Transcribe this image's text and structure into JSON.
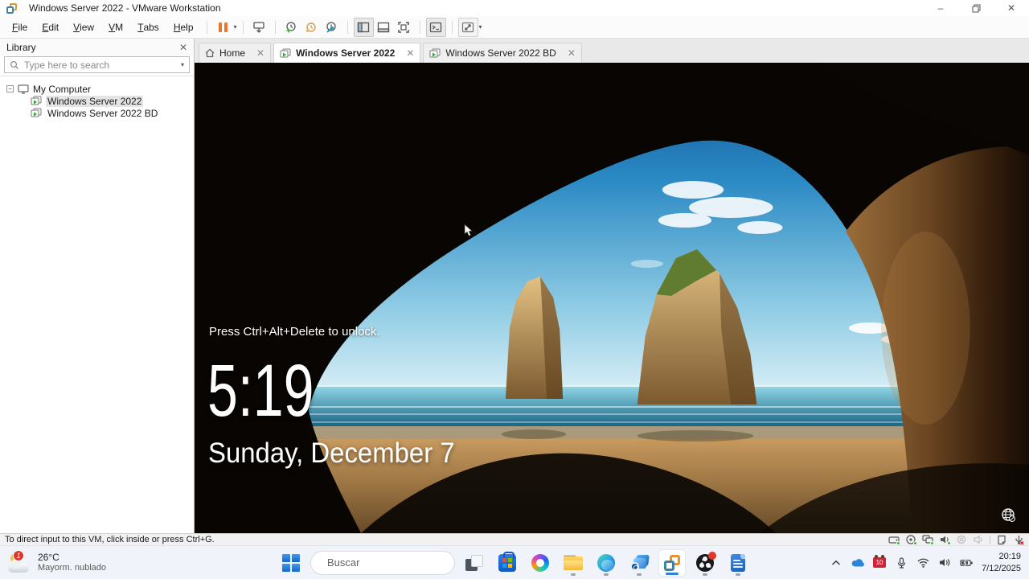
{
  "window": {
    "title": "Windows Server 2022 - VMware Workstation"
  },
  "menubar": {
    "items": [
      "File",
      "Edit",
      "View",
      "VM",
      "Tabs",
      "Help"
    ]
  },
  "library": {
    "title": "Library",
    "search_placeholder": "Type here to search",
    "root_label": "My Computer",
    "vms": [
      "Windows Server 2022",
      "Windows Server 2022 BD"
    ]
  },
  "tabbar": {
    "tabs": [
      "Home",
      "Windows Server 2022",
      "Windows Server 2022 BD"
    ]
  },
  "lock_screen": {
    "message": "Press Ctrl+Alt+Delete to unlock.",
    "time": "5:19",
    "date": "Sunday, December 7"
  },
  "statusbar": {
    "message": "To direct input to this VM, click inside or press Ctrl+G."
  },
  "taskbar": {
    "weather": {
      "temperature": "26°C",
      "condition": "Mayorm. nublado",
      "badge_count": "1"
    },
    "search_placeholder": "Buscar",
    "tray": {
      "reminder_badge": "10",
      "time": "20:19",
      "date": "7/12/2025"
    }
  },
  "colors": {
    "vmware_orange": "#e8762c",
    "vmware_blue": "#3f84a8",
    "taskbar_accent": "#2f81d6",
    "badge_red": "#d83b2e",
    "taskbar_bg": "#f0f4fa"
  }
}
